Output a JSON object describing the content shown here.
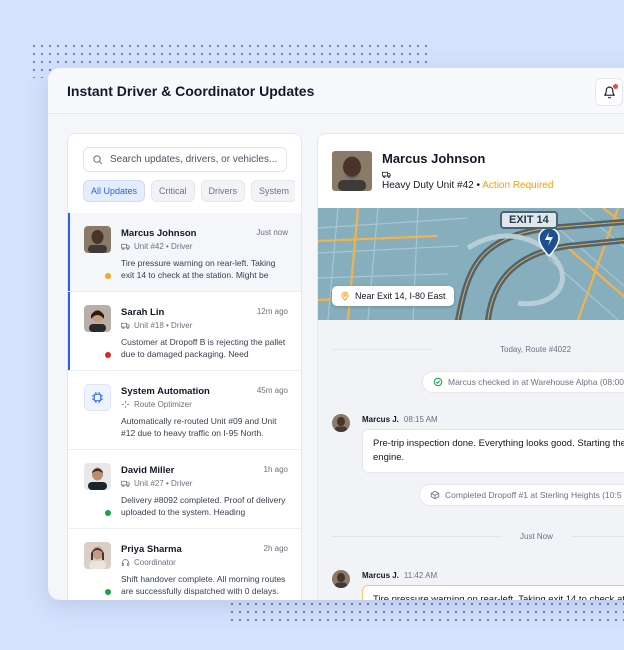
{
  "app": {
    "title": "Instant Driver & Coordinator Updates"
  },
  "search": {
    "placeholder": "Search updates, drivers, or vehicles..."
  },
  "filters": [
    "All Updates",
    "Critical",
    "Drivers",
    "System"
  ],
  "updates": [
    {
      "name": "Marcus Johnson",
      "time": "Just now",
      "meta": "Unit #42 • Driver",
      "meta_icon": "truck-icon",
      "body": "Tire pressure warning on rear-left. Taking exit 14 to check at the station. Might be",
      "status_color": "#f5a524",
      "selected": true,
      "unread": true
    },
    {
      "name": "Sarah Lin",
      "time": "12m ago",
      "meta": "Unit #18 • Driver",
      "meta_icon": "truck-icon",
      "body": "Customer at Dropoff B is rejecting the pallet due to damaged packaging. Need",
      "status_color": "#dc2626",
      "selected": false,
      "unread": true
    },
    {
      "name": "System Automation",
      "time": "45m ago",
      "meta": "Route Optimizer",
      "meta_icon": "sparkle-icon",
      "body": "Automatically re-routed Unit #09 and Unit #12 due to heavy traffic on I-95 North.",
      "status_color": "",
      "selected": false,
      "unread": false
    },
    {
      "name": "David Miller",
      "time": "1h ago",
      "meta": "Unit #27 • Driver",
      "meta_icon": "truck-icon",
      "body": "Delivery #8092 completed. Proof of delivery uploaded to the system. Heading",
      "status_color": "#16a34a",
      "selected": false,
      "unread": false
    },
    {
      "name": "Priya Sharma",
      "time": "2h ago",
      "meta": "Coordinator",
      "meta_icon": "headset-icon",
      "body": "Shift handover complete. All morning routes are successfully dispatched with 0 delays.",
      "status_color": "#16a34a",
      "selected": false,
      "unread": false
    }
  ],
  "detail": {
    "name": "Marcus Johnson",
    "unit": "Heavy Duty Unit #42",
    "separator": "•",
    "status": "Action Required",
    "status_color": "#f59e0b",
    "map": {
      "exit_sign": "EXIT 14",
      "location": "Near Exit 14, I-80 East"
    }
  },
  "chat": {
    "divider_1": "Today, Route #4022",
    "system_1": "Marcus checked in at Warehouse Alpha (08:00",
    "msg_1": {
      "sender": "Marcus J.",
      "time": "08:15 AM",
      "text": "Pre-trip inspection done. Everything looks good. Starting the engine."
    },
    "system_2": "Completed Dropoff #1 at Sterling Heights (10:5",
    "divider_2": "Just Now",
    "msg_2": {
      "sender": "Marcus J.",
      "time": "11:42 AM",
      "text": "Tire pressure warning on rear-left. Taking exit 14 to check at th"
    }
  },
  "colors": {
    "accent": "#2563eb",
    "warning": "#f59e0b",
    "background": "#d4e2fd"
  }
}
